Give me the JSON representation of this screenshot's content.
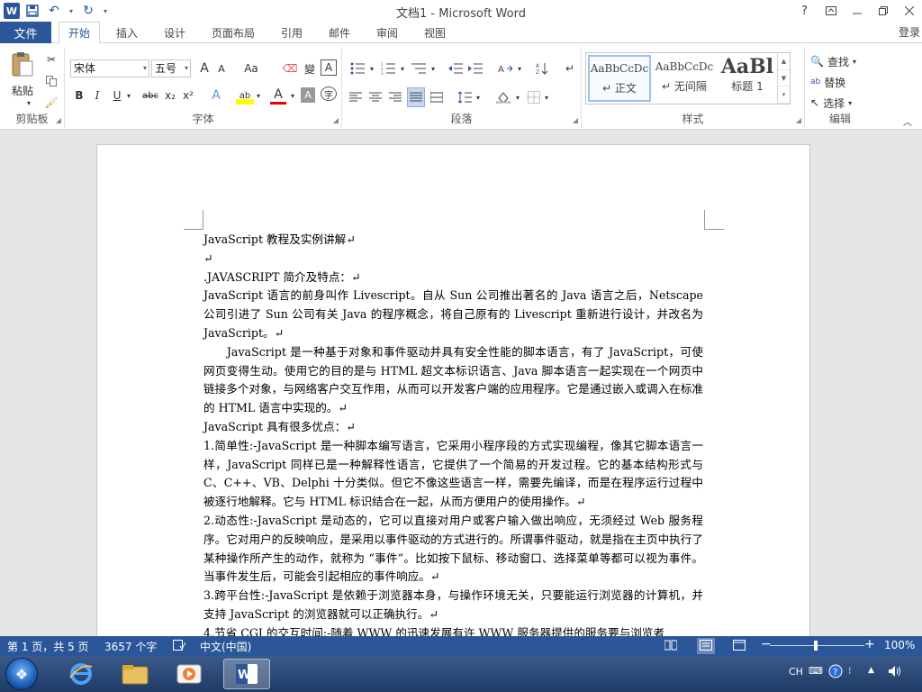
{
  "app": {
    "window_title": "文档1 - Microsoft Word",
    "logo_letter": "W",
    "login_label": "登录",
    "help_label": "?"
  },
  "tabs": {
    "file": "文件",
    "items": [
      "开始",
      "插入",
      "设计",
      "页面布局",
      "引用",
      "邮件",
      "审阅",
      "视图"
    ],
    "active": "开始"
  },
  "ribbon": {
    "clipboard": {
      "label": "剪贴板",
      "paste_label": "粘贴"
    },
    "font": {
      "label": "字体",
      "font_name": "宋体",
      "font_size": "五号",
      "grow_label": "A",
      "shrink_label": "A",
      "case_label": "Aa",
      "phonetic_label": "變",
      "border_char_label": "A",
      "bold": "B",
      "italic": "I",
      "underline": "U",
      "strike": "abc",
      "subscript": "x₂",
      "superscript": "x²",
      "effects": "A",
      "highlight": "ab",
      "font_color": "A",
      "shading": "A",
      "enclose": "字"
    },
    "paragraph": {
      "label": "段落"
    },
    "styles": {
      "label": "样式",
      "items": [
        {
          "sample": "AaBbCcDc",
          "name": "↵ 正文"
        },
        {
          "sample": "AaBbCcDc",
          "name": "↵ 无间隔"
        },
        {
          "sample": "AaBl",
          "name": "标题 1"
        }
      ]
    },
    "editing": {
      "label": "编辑",
      "find": "查找",
      "replace": "替换",
      "select": "选择"
    }
  },
  "document": {
    "paragraphs": [
      "JavaScript 教程及实例讲解↵",
      "↵",
      ".JAVASCRIPT 简介及特点：↵",
      "JavaScript 语言的前身叫作 Livescript。自从 Sun 公司推出著名的 Java 语言之后，Netscape 公司引进了 Sun 公司有关 Java 的程序概念，将自己原有的 Livescript 重新进行设计，并改名为 JavaScript。↵",
      "　　JavaScript 是一种基于对象和事件驱动并具有安全性能的脚本语言，有了 JavaScript，可使网页变得生动。使用它的目的是与 HTML 超文本标识语言、Java 脚本语言一起实现在一个网页中链接多个对象，与网络客户交互作用，从而可以开发客户端的应用程序。它是通过嵌入或调入在标准的 HTML 语言中实现的。↵",
      "JavaScript 具有很多优点：↵",
      "1.简单性:-JavaScript 是一种脚本编写语言，它采用小程序段的方式实现编程，像其它脚本语言一样，JavaScript 同样已是一种解释性语言，它提供了一个简易的开发过程。它的基本结构形式与 C、C++、VB、Delphi 十分类似。但它不像这些语言一样，需要先编译，而是在程序运行过程中被逐行地解释。它与 HTML 标识结合在一起，从而方便用户的使用操作。↵",
      "2.动态性:-JavaScript 是动态的，它可以直接对用户或客户输入做出响应，无须经过 Web 服务程序。它对用户的反映响应，是采用以事件驱动的方式进行的。所谓事件驱动，就是指在主页中执行了某种操作所产生的动作，就称为 “事件”。比如按下鼠标、移动窗口、选择菜单等都可以视为事件。当事件发生后，可能会引起相应的事件响应。↵",
      "3.跨平台性:-JavaScript 是依赖于浏览器本身，与操作环境无关，只要能运行浏览器的计算机，并支持 JavaScript 的浏览器就可以正确执行。↵",
      "4.节省 CGI 的交互时间:-随着 WWW 的迅速发展有许 WWW 服务器提供的服务要与浏览者"
    ]
  },
  "statusbar": {
    "page": "第 1 页，共 5 页",
    "words": "3657 个字",
    "language": "中文(中国)",
    "zoom": "100%",
    "zoom_minus": "−",
    "zoom_plus": "+"
  },
  "taskbar": {
    "tray_lang": "CH"
  },
  "colors": {
    "brand": "#2b579a",
    "status_bar": "#2b579a"
  }
}
